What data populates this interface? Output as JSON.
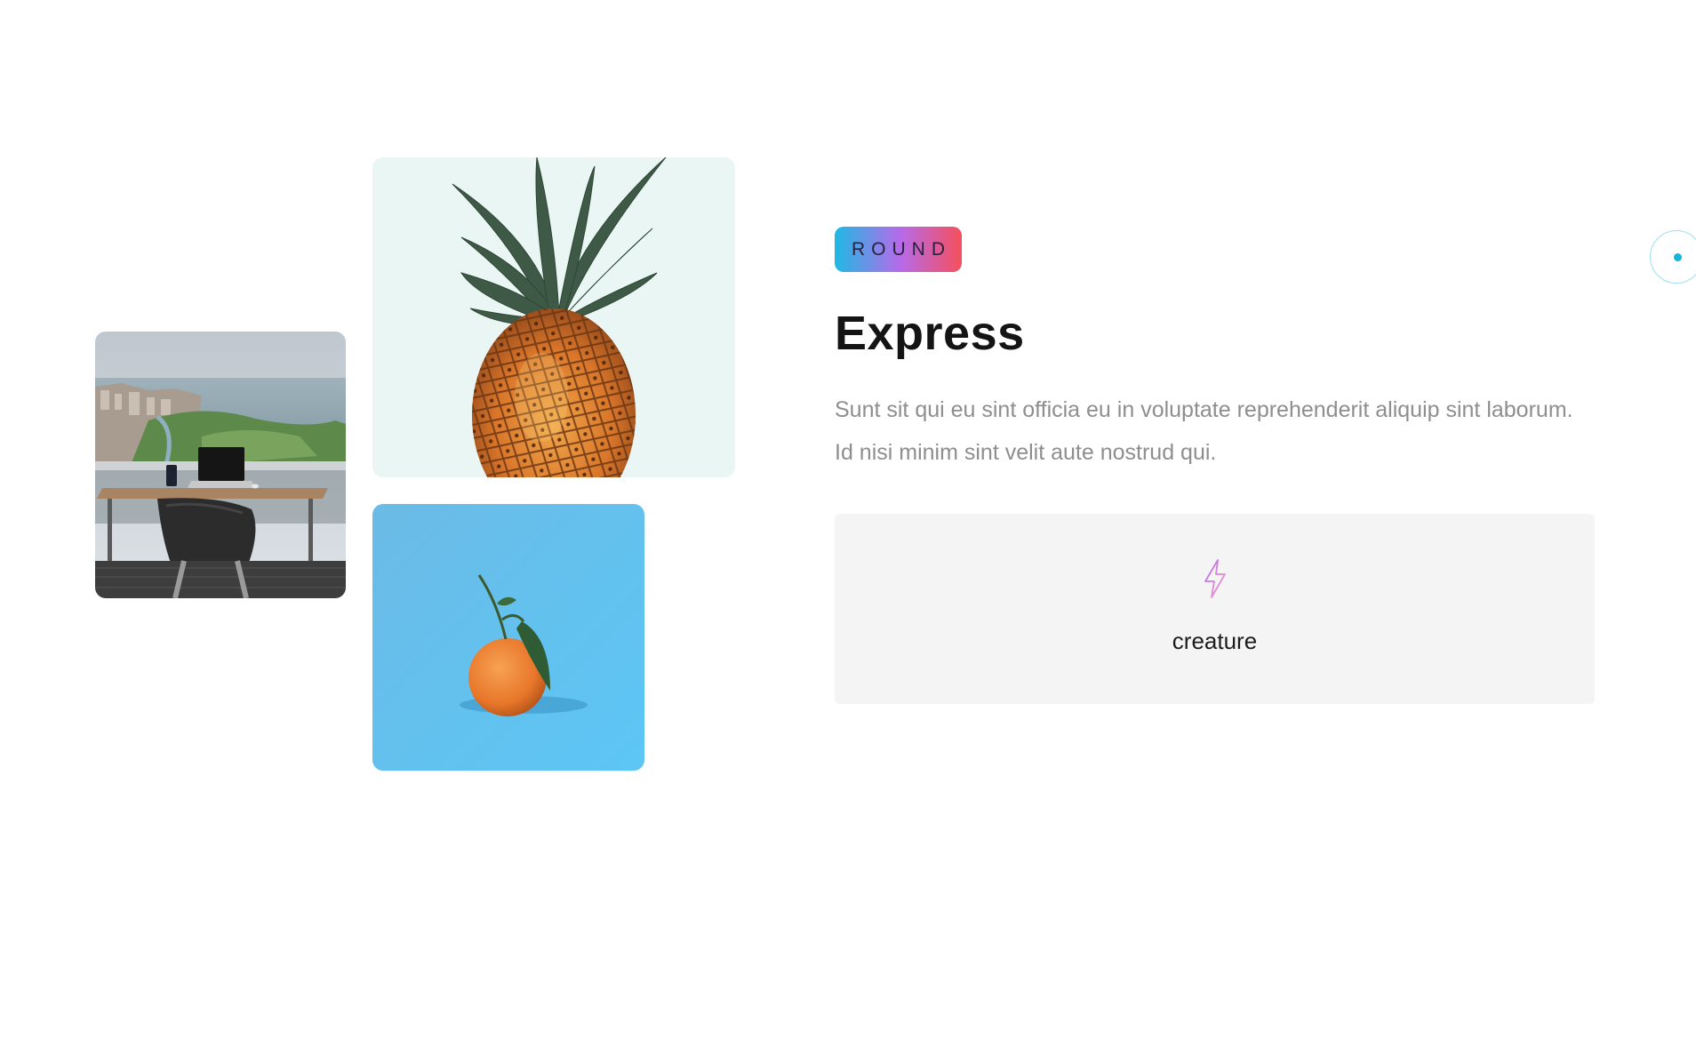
{
  "section": {
    "badge": "ROUND",
    "title": "Express",
    "description": "Sunt sit qui eu sint officia eu in voluptate reprehenderit aliquip sint laborum. Id nisi minim sint velit aute nostrud qui."
  },
  "images": [
    {
      "name": "office-desk-city-view",
      "subject": "office desk by window overlooking city and lake"
    },
    {
      "name": "pineapple",
      "subject": "pineapple on pale mint background"
    },
    {
      "name": "tangerine",
      "subject": "tangerine with leaf on blue background"
    }
  ],
  "feature": {
    "icon": "lightning-bolt-icon",
    "label": "creature"
  },
  "colors": {
    "badge_gradient": [
      "#1fb9e3",
      "#b76ae9",
      "#f5505d"
    ],
    "icon_gradient": [
      "#b76ae9",
      "#f5a0c8"
    ],
    "scroll_indicator": "#17b3d8",
    "card_background": "#f4f4f4"
  }
}
